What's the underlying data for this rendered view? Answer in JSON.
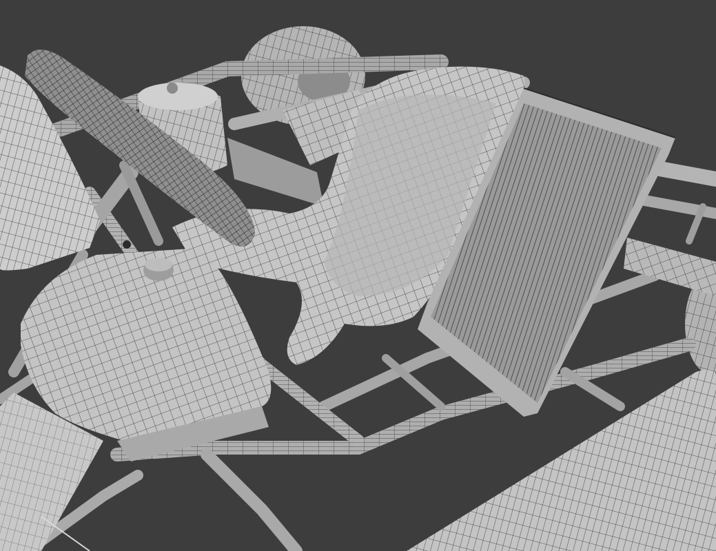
{
  "scene": {
    "subject": "go-kart-wireframe-render",
    "colors": {
      "background": "#3d3d3d",
      "surface_light": "#c9c9c9",
      "surface_mid": "#a8a8a8",
      "surface_dark": "#7a7a7a",
      "wire": "#2b2b2b"
    },
    "objects": [
      "steering-wheel",
      "seat",
      "radiator",
      "fuel-tank",
      "front-cowl",
      "side-pod",
      "frame-tubes",
      "rear-wheel-left",
      "rear-wheel-right",
      "air-filter",
      "exhaust"
    ]
  }
}
